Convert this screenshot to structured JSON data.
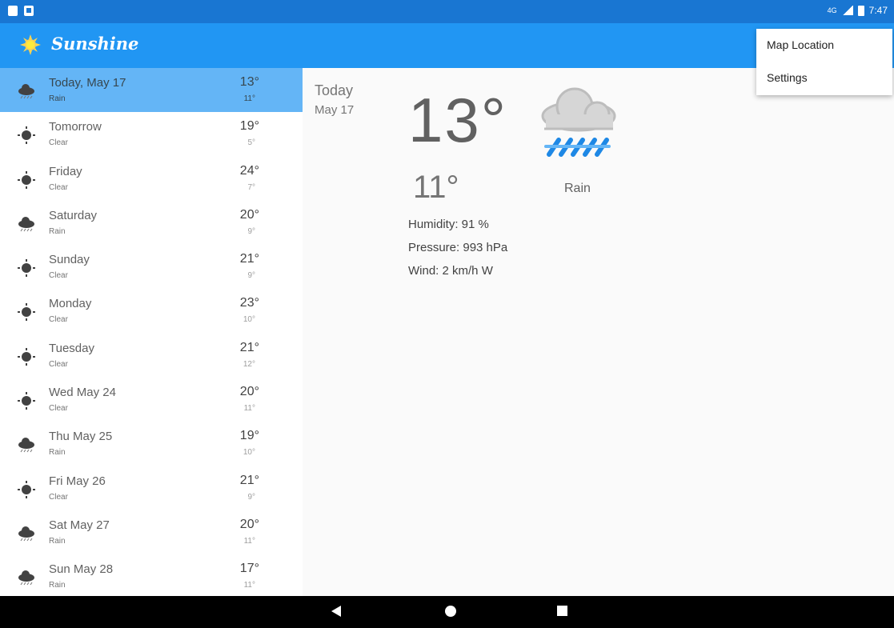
{
  "status_bar": {
    "time": "7:47",
    "network": "4G",
    "left_icons": [
      "sd-card-icon",
      "notification-a-icon"
    ]
  },
  "app_bar": {
    "title": "Sunshine",
    "logo_icon": "sun-icon"
  },
  "overflow_menu": {
    "items": [
      {
        "label": "Map Location"
      },
      {
        "label": "Settings"
      }
    ]
  },
  "forecast": [
    {
      "day": "Today, May 17",
      "desc": "Rain",
      "high": "13°",
      "low": "11°",
      "icon": "rain-icon",
      "selected": true
    },
    {
      "day": "Tomorrow",
      "desc": "Clear",
      "high": "19°",
      "low": "5°",
      "icon": "clear-icon"
    },
    {
      "day": "Friday",
      "desc": "Clear",
      "high": "24°",
      "low": "7°",
      "icon": "clear-icon"
    },
    {
      "day": "Saturday",
      "desc": "Rain",
      "high": "20°",
      "low": "9°",
      "icon": "rain-icon"
    },
    {
      "day": "Sunday",
      "desc": "Clear",
      "high": "21°",
      "low": "9°",
      "icon": "clear-icon"
    },
    {
      "day": "Monday",
      "desc": "Clear",
      "high": "23°",
      "low": "10°",
      "icon": "clear-icon"
    },
    {
      "day": "Tuesday",
      "desc": "Clear",
      "high": "21°",
      "low": "12°",
      "icon": "clear-icon"
    },
    {
      "day": "Wed May 24",
      "desc": "Clear",
      "high": "20°",
      "low": "11°",
      "icon": "clear-icon"
    },
    {
      "day": "Thu May 25",
      "desc": "Rain",
      "high": "19°",
      "low": "10°",
      "icon": "rain-icon"
    },
    {
      "day": "Fri May 26",
      "desc": "Clear",
      "high": "21°",
      "low": "9°",
      "icon": "clear-icon"
    },
    {
      "day": "Sat May 27",
      "desc": "Rain",
      "high": "20°",
      "low": "11°",
      "icon": "rain-icon"
    },
    {
      "day": "Sun May 28",
      "desc": "Rain",
      "high": "17°",
      "low": "11°",
      "icon": "rain-icon"
    }
  ],
  "detail": {
    "day": "Today",
    "date": "May 17",
    "high": "13°",
    "low": "11°",
    "desc": "Rain",
    "art_icon": "rain-art-icon",
    "humidity": "Humidity: 91 %",
    "pressure": "Pressure: 993 hPa",
    "wind": "Wind: 2 km/h W"
  },
  "colors": {
    "status_bar": "#1976d2",
    "app_bar": "#2196f3",
    "selected_row": "#64b5f6",
    "background": "#fafafa"
  }
}
